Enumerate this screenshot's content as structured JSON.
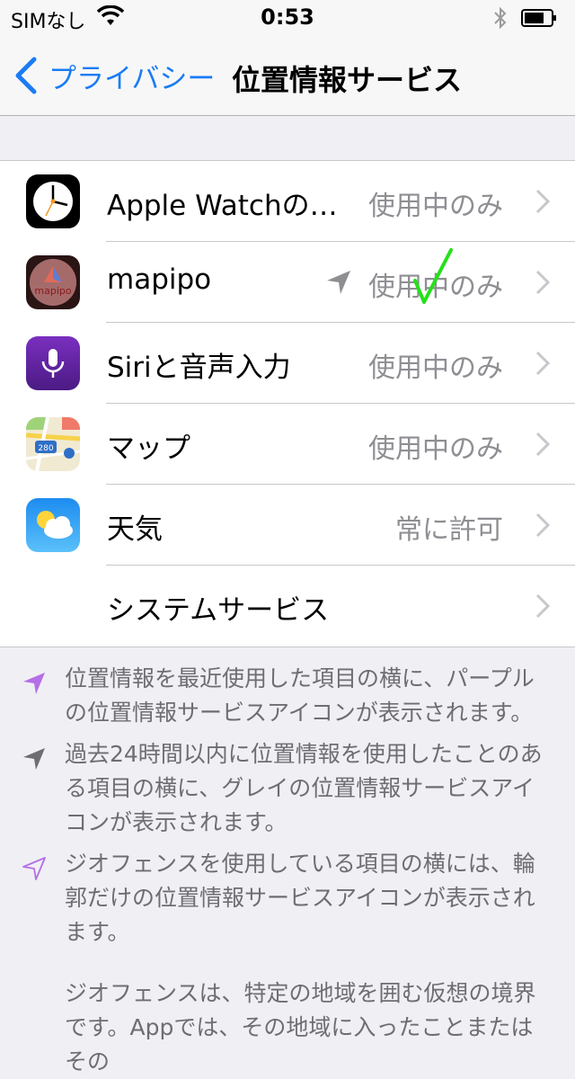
{
  "status_bar": {
    "carrier": "SIMなし",
    "time": "0:53",
    "icons": [
      "wifi-icon",
      "bluetooth-icon",
      "battery-icon"
    ]
  },
  "nav": {
    "back_label": "プライバシー",
    "title": "位置情報サービス"
  },
  "rows": [
    {
      "icon": "apple-watch-clock-icon",
      "label": "Apple Watchの…",
      "value": "使用中のみ",
      "location_indicator": false
    },
    {
      "icon": "mapipo-app-icon",
      "label": "mapipo",
      "value": "使用中のみ",
      "location_indicator": "gray"
    },
    {
      "icon": "siri-mic-icon",
      "label": "Siriと音声入力",
      "value": "使用中のみ",
      "location_indicator": false
    },
    {
      "icon": "maps-app-icon",
      "label": "マップ",
      "value": "使用中のみ",
      "location_indicator": false
    },
    {
      "icon": "weather-app-icon",
      "label": "天気",
      "value": "常に許可",
      "location_indicator": false
    },
    {
      "icon": null,
      "label": "システムサービス",
      "value": "",
      "location_indicator": false
    }
  ],
  "mapipo_icon_text": "mapipo",
  "maps_icon_text": "280",
  "notes": [
    {
      "icon": "location-arrow-purple-icon",
      "text": "位置情報を最近使用した項目の横に、パープルの位置情報サービスアイコンが表示されます。"
    },
    {
      "icon": "location-arrow-gray-icon",
      "text": "過去24時間以内に位置情報を使用したことのある項目の横に、グレイの位置情報サービスアイコンが表示されます。"
    },
    {
      "icon": "location-arrow-outline-icon",
      "text": "ジオフェンスを使用している項目の横には、輪郭だけの位置情報サービスアイコンが表示されます。"
    },
    {
      "icon": null,
      "text": "ジオフェンスは、特定の地域を囲む仮想の境界です。Appでは、その地域に入ったことまたはその"
    }
  ],
  "colors": {
    "accent": "#1a7cf5",
    "secondary_text": "#8e8e93",
    "footer_text": "#6d6d72",
    "purple": "#b46fe6",
    "gray_arrow": "#8e8e93",
    "check_green": "#25e01a"
  }
}
